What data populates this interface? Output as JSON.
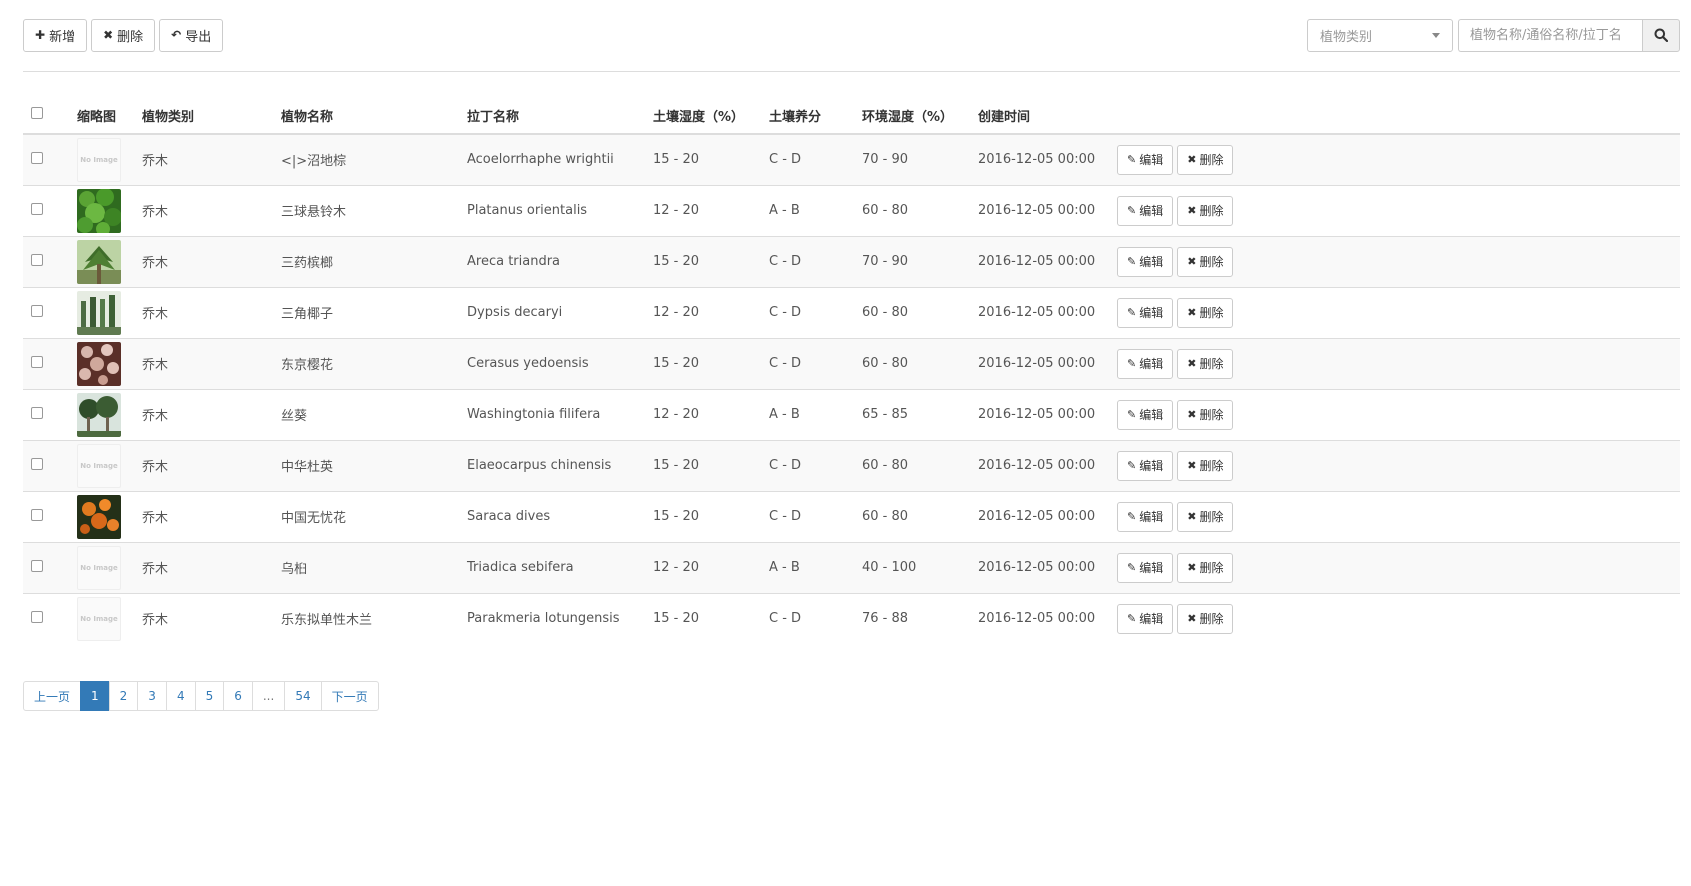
{
  "toolbar": {
    "add_label": "新增",
    "delete_label": "删除",
    "export_label": "导出",
    "category_select": "植物类别",
    "search_placeholder": "植物名称/通俗名称/拉丁名"
  },
  "table": {
    "headers": [
      "缩略图",
      "植物类别",
      "植物名称",
      "拉丁名称",
      "土壤湿度（%）",
      "土壤养分",
      "环境湿度（%）",
      "创建时间"
    ],
    "rows": [
      {
        "thumb": "no-image",
        "category": "乔木",
        "name": "<|>沼地棕",
        "latin": "Acoelorrhaphe wrightii",
        "soil_humidity": "15 - 20",
        "nutrient": "C - D",
        "env_humidity": "70 - 90",
        "created": "2016-12-05 00:00"
      },
      {
        "thumb": "green-leaves",
        "category": "乔木",
        "name": "三球悬铃木",
        "latin": "Platanus orientalis",
        "soil_humidity": "12 - 20",
        "nutrient": "A - B",
        "env_humidity": "60 - 80",
        "created": "2016-12-05 00:00"
      },
      {
        "thumb": "palm-tree",
        "category": "乔木",
        "name": "三药槟榔",
        "latin": "Areca triandra",
        "soil_humidity": "15 - 20",
        "nutrient": "C - D",
        "env_humidity": "70 - 90",
        "created": "2016-12-05 00:00"
      },
      {
        "thumb": "palm-grove",
        "category": "乔木",
        "name": "三角椰子",
        "latin": "Dypsis decaryi",
        "soil_humidity": "12 - 20",
        "nutrient": "C - D",
        "env_humidity": "60 - 80",
        "created": "2016-12-05 00:00"
      },
      {
        "thumb": "cherry-blossom",
        "category": "乔木",
        "name": "东京樱花",
        "latin": "Cerasus yedoensis",
        "soil_humidity": "15 - 20",
        "nutrient": "C - D",
        "env_humidity": "60 - 80",
        "created": "2016-12-05 00:00"
      },
      {
        "thumb": "fan-palm",
        "category": "乔木",
        "name": "丝葵",
        "latin": "Washingtonia filifera",
        "soil_humidity": "12 - 20",
        "nutrient": "A - B",
        "env_humidity": "65 - 85",
        "created": "2016-12-05 00:00"
      },
      {
        "thumb": "no-image",
        "category": "乔木",
        "name": "中华杜英",
        "latin": "Elaeocarpus chinensis",
        "soil_humidity": "15 - 20",
        "nutrient": "C - D",
        "env_humidity": "60 - 80",
        "created": "2016-12-05 00:00"
      },
      {
        "thumb": "orange-flowers",
        "category": "乔木",
        "name": "中国无忧花",
        "latin": "Saraca dives",
        "soil_humidity": "15 - 20",
        "nutrient": "C - D",
        "env_humidity": "60 - 80",
        "created": "2016-12-05 00:00"
      },
      {
        "thumb": "no-image",
        "category": "乔木",
        "name": "乌桕",
        "latin": "Triadica sebifera",
        "soil_humidity": "12 - 20",
        "nutrient": "A - B",
        "env_humidity": "40 - 100",
        "created": "2016-12-05 00:00"
      },
      {
        "thumb": "no-image",
        "category": "乔木",
        "name": "乐东拟单性木兰",
        "latin": "Parakmeria lotungensis",
        "soil_humidity": "15 - 20",
        "nutrient": "C - D",
        "env_humidity": "76 - 88",
        "created": "2016-12-05 00:00"
      }
    ],
    "row_actions": {
      "edit_label": "编辑",
      "delete_label": "删除"
    },
    "no_image_text": "No Image"
  },
  "pagination": {
    "prev": "上一页",
    "pages": [
      "1",
      "2",
      "3",
      "4",
      "5",
      "6",
      "...",
      "54"
    ],
    "next": "下一页",
    "current": "1"
  },
  "colors": {
    "accent": "#337ab7",
    "border": "#dddddd",
    "stripe": "#f9f9f9"
  }
}
